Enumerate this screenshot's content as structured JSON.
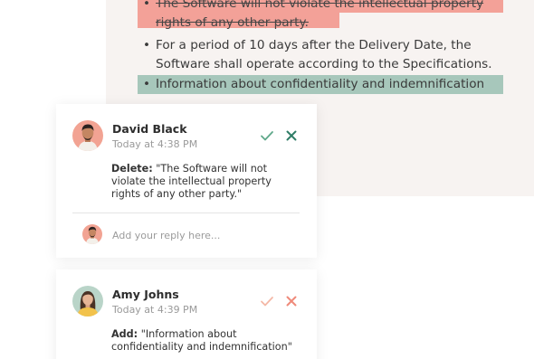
{
  "document": {
    "deleted_line1": "The Software will not violate the intellectual property",
    "deleted_line2": "rights of any other party.",
    "normal_line1": "For a period of 10 days after the Delivery Date, the",
    "normal_line2": "Software shall operate according to the Specifications.",
    "added_line": "Information about confidentiality and indemnification",
    "bullet": "•"
  },
  "comments": [
    {
      "author": "David Black",
      "time": "Today at 4:38 PM",
      "action_label": "Delete:",
      "line1": "\"The Software will not",
      "line2": "violate the intellectual property",
      "line3": "rights of any other party.\"",
      "reply_placeholder": "Add your reply here..."
    },
    {
      "author": "Amy Johns",
      "time": "Today at 4:39 PM",
      "action_label": "Add:",
      "line1": "\"Information about",
      "line2": "confidentiality and indemnification\""
    }
  ],
  "colors": {
    "delete_highlight": "#f3a198",
    "add_highlight": "#a7c7bb",
    "accept_active": "#5fa88a",
    "reject_active": "#2f7d67",
    "accept_muted": "#f4b8a6",
    "reject_muted": "#ef8a7a"
  },
  "icons": {
    "accept": "check-icon",
    "reject": "close-icon"
  }
}
